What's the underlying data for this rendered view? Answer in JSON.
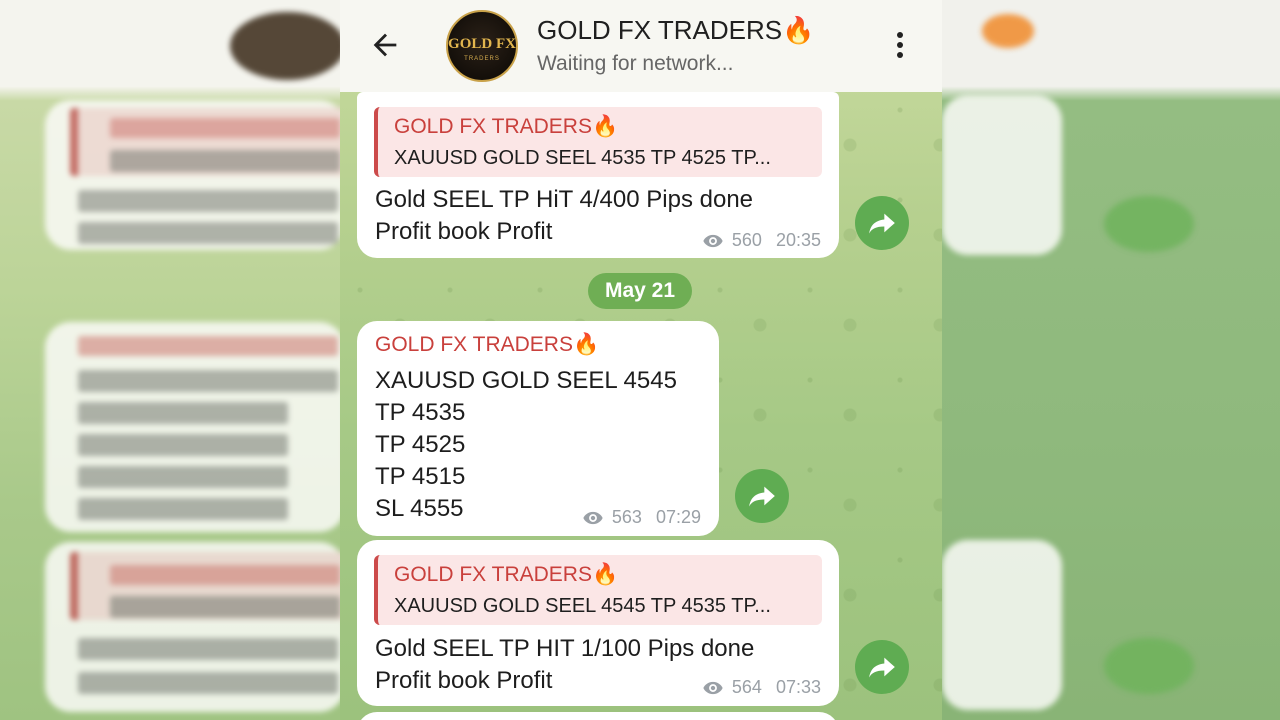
{
  "header": {
    "title": "GOLD FX TRADERS🔥",
    "status": "Waiting for network...",
    "avatar_logo_text": "GOLD FX",
    "avatar_logo_sub": "TRADERS"
  },
  "messages": [
    {
      "quote_author": "GOLD FX TRADERS🔥",
      "quote_text": "XAUUSD GOLD SEEL 4535 TP 4525 TP...",
      "lines": [
        "Gold SEEL TP HiT 4/400 Pips done",
        "Profit book Profit"
      ],
      "views": "560",
      "time": "20:35"
    },
    {
      "author": "GOLD FX TRADERS🔥",
      "lines": [
        "XAUUSD GOLD SEEL 4545",
        "TP 4535",
        "TP 4525",
        "TP 4515",
        "SL 4555"
      ],
      "views": "563",
      "time": "07:29"
    },
    {
      "quote_author": "GOLD FX TRADERS🔥",
      "quote_text": "XAUUSD GOLD SEEL 4545 TP 4535 TP...",
      "lines": [
        "Gold SEEL TP HIT 1/100 Pips done",
        "Profit book Profit"
      ],
      "views": "564",
      "time": "07:33"
    }
  ],
  "date_separator": "May 21",
  "icons": {
    "back": "arrow-left-icon",
    "menu": "more-vert-icon",
    "views": "eye-icon",
    "forward": "share-arrow-icon"
  },
  "colors": {
    "accent_green": "#5fac52",
    "author_red": "#c9403c",
    "quote_bg": "#fbe6e6"
  }
}
